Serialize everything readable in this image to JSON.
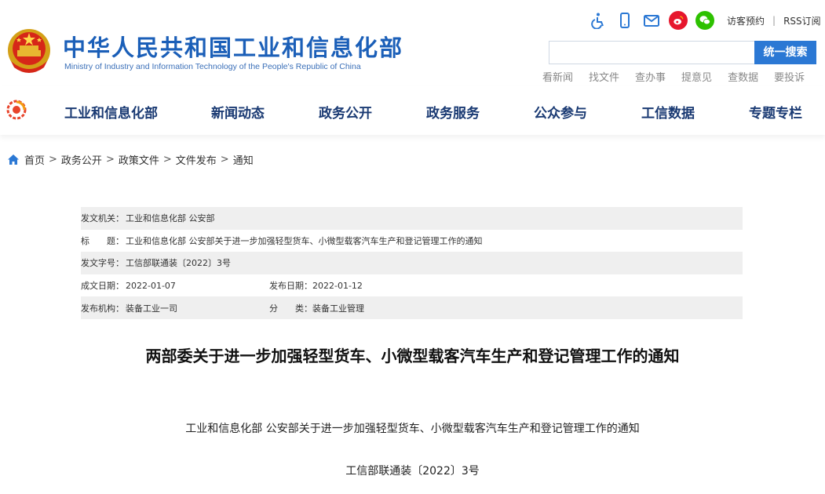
{
  "header": {
    "site_title": "中华人民共和国工业和信息化部",
    "site_subtitle": "Ministry of Industry and Information Technology of the People's Republic of China",
    "top_links": {
      "visitor": "访客预约",
      "separator": "|",
      "rss": "RSS订阅"
    },
    "icons": [
      "accessibility-icon",
      "mobile-icon",
      "mail-icon",
      "weibo-icon",
      "wechat-icon"
    ],
    "search": {
      "placeholder": "",
      "button_label": "统一搜索"
    },
    "quick_links": [
      "看新闻",
      "找文件",
      "查办事",
      "提意见",
      "查数据",
      "要投诉"
    ],
    "colors": {
      "title_blue": "#1b5fb8",
      "search_button": "#2b78d4",
      "nav_text": "#1a3a73"
    }
  },
  "nav": {
    "items": [
      "工业和信息化部",
      "新闻动态",
      "政务公开",
      "政务服务",
      "公众参与",
      "工信数据",
      "专题专栏"
    ]
  },
  "breadcrumb": {
    "items": [
      "首页",
      "政务公开",
      "政策文件",
      "文件发布",
      "通知"
    ],
    "separator": ">"
  },
  "info": {
    "issuer_label": "发文机关：",
    "issuer": "工业和信息化部 公安部",
    "title_label": "标　　题：",
    "title": "工业和信息化部 公安部关于进一步加强轻型货车、小微型载客汽车生产和登记管理工作的通知",
    "doc_no_label": "发文字号：",
    "doc_no": "工信部联通装〔2022〕3号",
    "written_label": "成文日期：",
    "written_date": "2022-01-07",
    "published_label": "发布日期：",
    "published_date": "2022-01-12",
    "org_label": "发布机构：",
    "org": "装备工业一司",
    "category_label": "分　　类：",
    "category": "装备工业管理"
  },
  "document": {
    "heading": "两部委关于进一步加强轻型货车、小微型载客汽车生产和登记管理工作的通知",
    "subtitle": "工业和信息化部 公安部关于进一步加强轻型货车、小微型载客汽车生产和登记管理工作的通知",
    "doc_number": "工信部联通装〔2022〕3号"
  }
}
